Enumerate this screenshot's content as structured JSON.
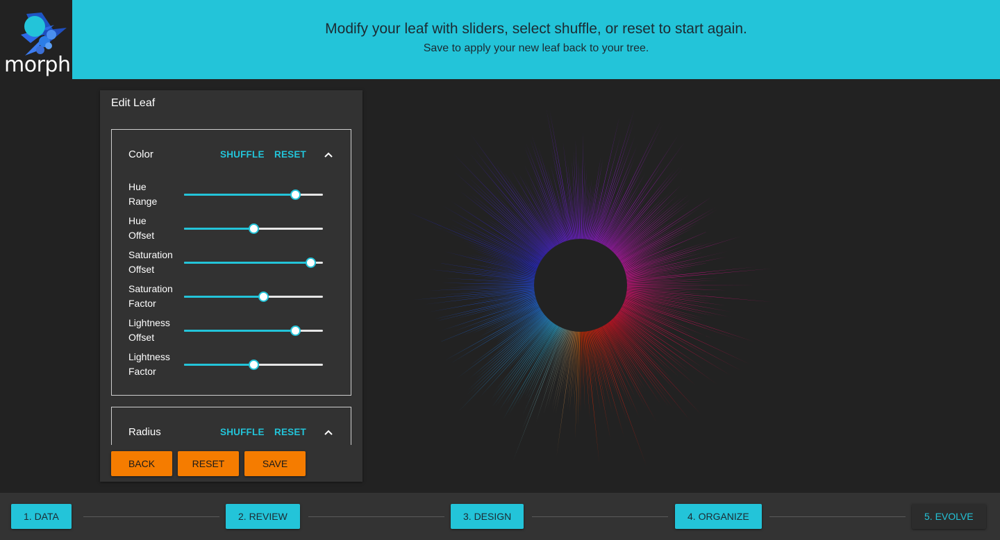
{
  "app": {
    "logo_text": "morph"
  },
  "header": {
    "title": "Modify your leaf with sliders, select shuffle, or reset to start again.",
    "subtitle": "Save to apply your new leaf back to your tree."
  },
  "panel": {
    "title": "Edit Leaf",
    "color_section": {
      "title": "Color",
      "shuffle": "SHUFFLE",
      "reset": "RESET",
      "sliders": [
        {
          "label_1": "Hue",
          "label_2": "Range",
          "value": 0.8
        },
        {
          "label_1": "Hue",
          "label_2": "Offset",
          "value": 0.5
        },
        {
          "label_1": "Saturation",
          "label_2": "Offset",
          "value": 0.91
        },
        {
          "label_1": "Saturation",
          "label_2": "Factor",
          "value": 0.57
        },
        {
          "label_1": "Lightness",
          "label_2": "Offset",
          "value": 0.8
        },
        {
          "label_1": "Lightness",
          "label_2": "Factor",
          "value": 0.5
        }
      ]
    },
    "radius_section": {
      "title": "Radius",
      "shuffle": "SHUFFLE",
      "reset": "RESET"
    },
    "buttons": {
      "back": "BACK",
      "reset": "RESET",
      "save": "SAVE"
    }
  },
  "steps": [
    {
      "label": "1. DATA",
      "active": false
    },
    {
      "label": "2. REVIEW",
      "active": false
    },
    {
      "label": "3. DESIGN",
      "active": false
    },
    {
      "label": "4. ORGANIZE",
      "active": false
    },
    {
      "label": "5. EVOLVE",
      "active": true
    }
  ],
  "colors": {
    "accent": "#23c4d9",
    "action": "#f57c00",
    "background": "#222222",
    "panel": "#323232"
  }
}
